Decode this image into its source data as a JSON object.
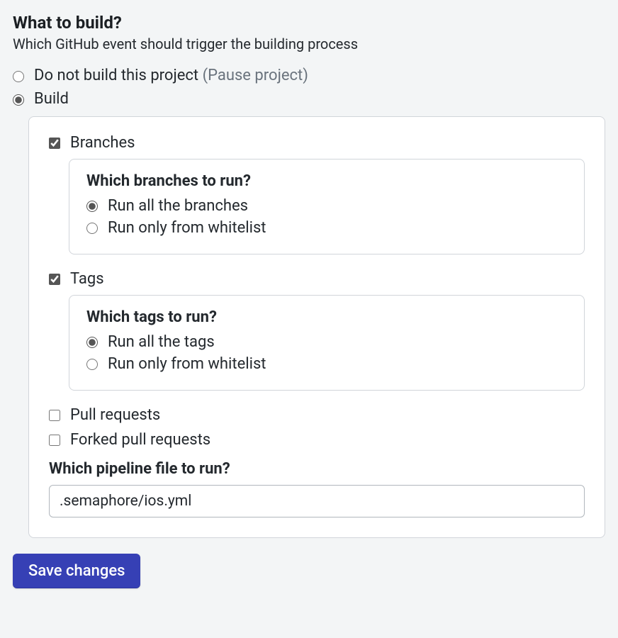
{
  "header": {
    "title": "What to build?",
    "subtitle": "Which GitHub event should trigger the building process"
  },
  "build_mode": {
    "do_not_build_label": "Do not build this project ",
    "do_not_build_hint": "(Pause project)",
    "build_label": "Build",
    "selected": "build"
  },
  "branches": {
    "checkbox_label": "Branches",
    "checked": true,
    "panel_title": "Which branches to run?",
    "option_all": "Run all the branches",
    "option_whitelist": "Run only from whitelist",
    "selected": "all"
  },
  "tags": {
    "checkbox_label": "Tags",
    "checked": true,
    "panel_title": "Which tags to run?",
    "option_all": "Run all the tags",
    "option_whitelist": "Run only from whitelist",
    "selected": "all"
  },
  "pull_requests": {
    "label": "Pull requests",
    "checked": false
  },
  "forked_pull_requests": {
    "label": "Forked pull requests",
    "checked": false
  },
  "pipeline": {
    "label": "Which pipeline file to run?",
    "value": ".semaphore/ios.yml"
  },
  "actions": {
    "save": "Save changes"
  }
}
